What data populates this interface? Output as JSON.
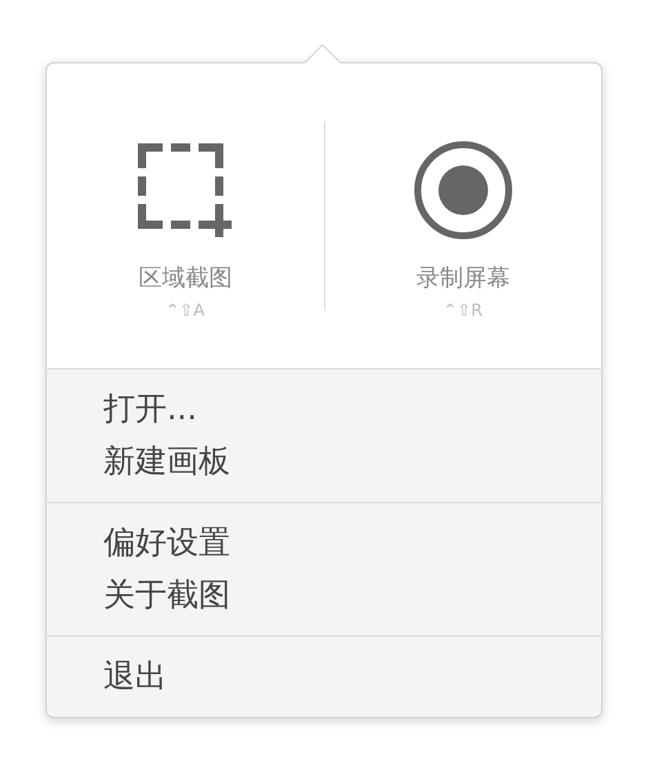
{
  "actions": [
    {
      "kind": "region",
      "label": "区域截图",
      "shortcut": "⌃⇧A"
    },
    {
      "kind": "record",
      "label": "录制屏幕",
      "shortcut": "⌃⇧R"
    }
  ],
  "menu_groups": [
    {
      "items": [
        "打开...",
        "新建画板"
      ]
    },
    {
      "items": [
        "偏好设置",
        "关于截图"
      ]
    },
    {
      "items": [
        "退出"
      ]
    }
  ]
}
